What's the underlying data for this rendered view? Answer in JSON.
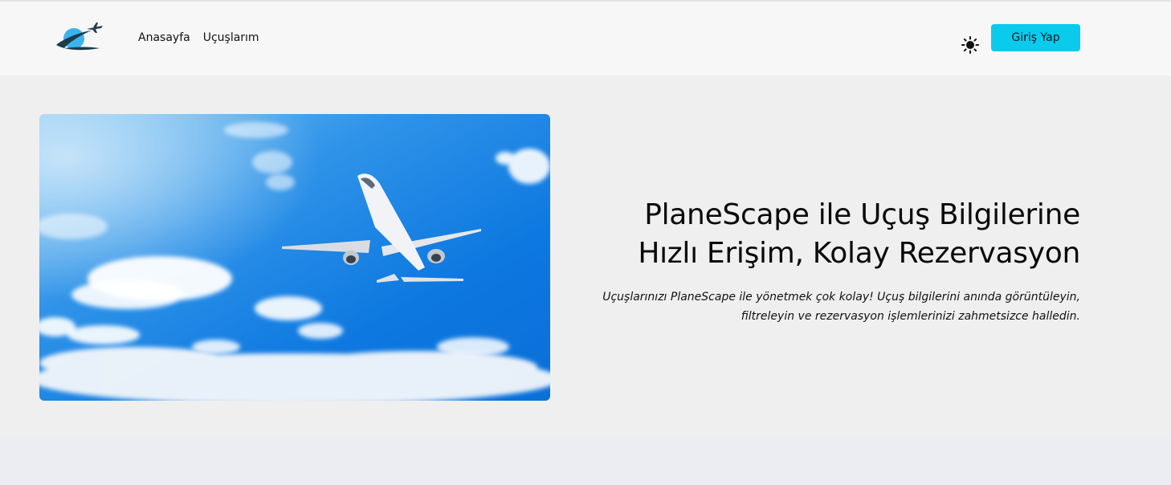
{
  "header": {
    "nav": [
      {
        "label": "Anasayfa"
      },
      {
        "label": "Uçuşlarım"
      }
    ],
    "theme_icon": "sun-icon",
    "login_label": "Giriş Yap"
  },
  "hero": {
    "title_line1": "PlaneScape ile Uçuş Bilgilerine",
    "title_line2": "Hızlı Erişim, Kolay Rezervasyon",
    "subtitle_line1": "Uçuşlarınızı PlaneScape ile yönetmek çok kolay! Uçuş bilgilerini anında görüntüleyin,",
    "subtitle_line2": "filtreleyin ve rezervasyon işlemlerinizi zahmetsizce halledin.",
    "image": "airplane-in-sky"
  },
  "colors": {
    "accent": "#0bcbec",
    "logo_planet": "#3bb4ee",
    "logo_ring": "#1d3b4d"
  }
}
